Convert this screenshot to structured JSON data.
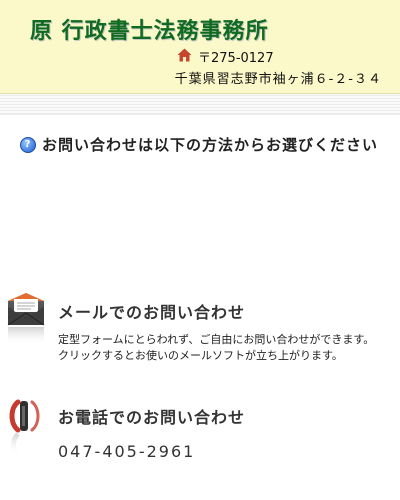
{
  "header": {
    "office_name": "原 行政書士法務事務所",
    "postal": "〒275-0127",
    "address": "千葉県習志野市袖ヶ浦６-２-３４"
  },
  "notice": {
    "text": "お問い合わせは以下の方法からお選びください"
  },
  "mail": {
    "title": "メールでのお問い合わせ",
    "desc1": "定型フォームにとらわれず、ご自由にお問い合わせができます。",
    "desc2": "クリックするとお使いのメールソフトが立ち上がります。"
  },
  "tel": {
    "title": "お電話でのお問い合わせ",
    "number": "047-405-2961"
  },
  "colors": {
    "header_bg": "#fbf8c9",
    "office_name": "#0f6b1f"
  }
}
